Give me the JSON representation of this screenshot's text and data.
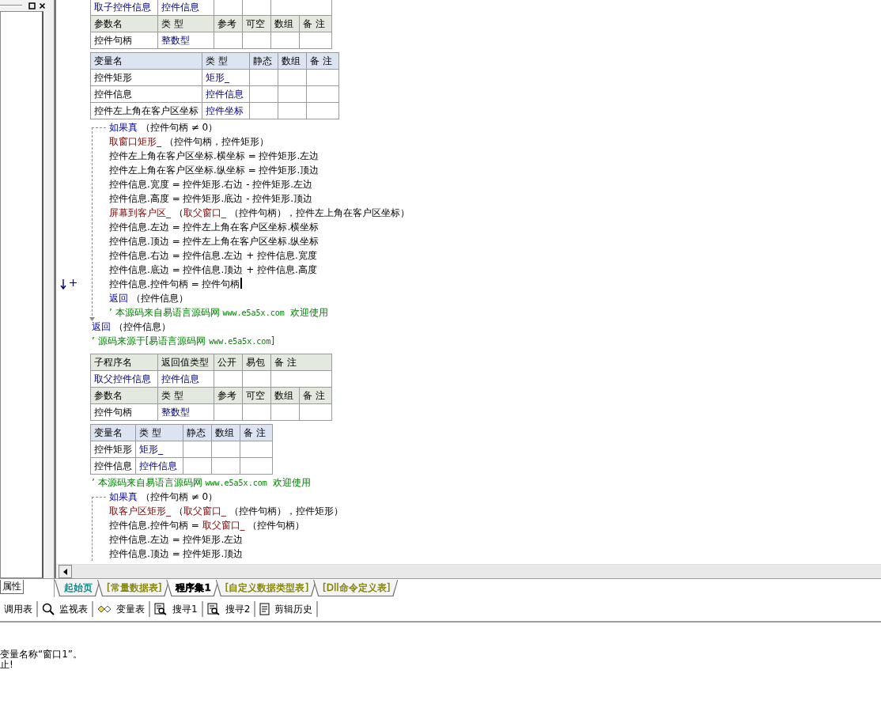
{
  "left_panel": {
    "tab": "属性"
  },
  "program": [
    {
      "kind": "sub_table",
      "row": {
        "name": "取子控件信息",
        "type": "控件信息"
      },
      "param_header": [
        "参数名",
        "类 型",
        "参考",
        "可空",
        "数组",
        "备 注"
      ],
      "params": [
        {
          "name": "控件句柄",
          "type": "整数型"
        }
      ]
    },
    {
      "kind": "var_table",
      "header": [
        "变量名",
        "类 型",
        "静态",
        "数组",
        "备 注"
      ],
      "rows": [
        {
          "name": "控件矩形",
          "type": "矩形_"
        },
        {
          "name": "控件信息",
          "type": "控件信息"
        },
        {
          "name": "控件左上角在客户区坐标",
          "type": "控件坐标"
        }
      ]
    },
    {
      "kind": "code",
      "lines": [
        {
          "kind": "if",
          "current": false,
          "end_arrow": true,
          "segments": [
            {
              "kind": "kw",
              "text": "如果真"
            },
            {
              "kind": "text",
              "text": " （控件句柄 ≠ 0）"
            }
          ],
          "children": [
            {
              "kind": "line",
              "current": false,
              "segments": [
                {
                  "kind": "fn",
                  "text": "取窗口矩形_"
                },
                {
                  "kind": "text",
                  "text": " （控件句柄，控件矩形）"
                }
              ]
            },
            {
              "kind": "line",
              "current": false,
              "segments": [
                {
                  "kind": "text",
                  "text": "控件左上角在客户区坐标.横坐标 = 控件矩形.左边"
                }
              ]
            },
            {
              "kind": "line",
              "current": false,
              "segments": [
                {
                  "kind": "text",
                  "text": "控件左上角在客户区坐标.纵坐标 = 控件矩形.顶边"
                }
              ]
            },
            {
              "kind": "line",
              "current": false,
              "segments": [
                {
                  "kind": "text",
                  "text": "控件信息.宽度 = 控件矩形.右边 - 控件矩形.左边"
                }
              ]
            },
            {
              "kind": "line",
              "current": false,
              "segments": [
                {
                  "kind": "text",
                  "text": "控件信息.高度 = 控件矩形.底边 - 控件矩形.顶边"
                }
              ]
            },
            {
              "kind": "line",
              "current": false,
              "segments": [
                {
                  "kind": "fn",
                  "text": "屏幕到客户区_"
                },
                {
                  "kind": "text",
                  "text": " （"
                },
                {
                  "kind": "fn",
                  "text": "取父窗口_"
                },
                {
                  "kind": "text",
                  "text": " （控件句柄），控件左上角在客户区坐标）"
                }
              ]
            },
            {
              "kind": "line",
              "current": false,
              "segments": [
                {
                  "kind": "text",
                  "text": "控件信息.左边 = 控件左上角在客户区坐标.横坐标"
                }
              ]
            },
            {
              "kind": "line",
              "current": false,
              "segments": [
                {
                  "kind": "text",
                  "text": "控件信息.顶边 = 控件左上角在客户区坐标.纵坐标"
                }
              ]
            },
            {
              "kind": "line",
              "current": false,
              "segments": [
                {
                  "kind": "text",
                  "text": "控件信息.右边 = 控件信息.左边 + 控件信息.宽度"
                }
              ]
            },
            {
              "kind": "line",
              "current": false,
              "segments": [
                {
                  "kind": "text",
                  "text": "控件信息.底边 = 控件信息.顶边 + 控件信息.高度"
                }
              ]
            },
            {
              "kind": "line",
              "current": true,
              "segments": [
                {
                  "kind": "text",
                  "text": "控件信息.控件句柄 = 控件句柄"
                }
              ]
            },
            {
              "kind": "line",
              "current": false,
              "segments": [
                {
                  "kind": "kw",
                  "text": "返回"
                },
                {
                  "kind": "text",
                  "text": " （控件信息）"
                }
              ]
            },
            {
              "kind": "line",
              "current": false,
              "segments": [
                {
                  "kind": "comment",
                  "text": "’ 本源码来自易语言源码网 "
                },
                {
                  "kind": "url",
                  "text": "www.e5a5x.com"
                },
                {
                  "kind": "comment",
                  "text": "  欢迎使用"
                }
              ]
            }
          ]
        },
        {
          "kind": "line",
          "current": false,
          "segments": [
            {
              "kind": "kw",
              "text": "返回"
            },
            {
              "kind": "text",
              "text": " （控件信息）"
            }
          ]
        },
        {
          "kind": "line",
          "current": false,
          "segments": [
            {
              "kind": "comment",
              "text": "’ 源码来源于[易语言源码网 "
            },
            {
              "kind": "url",
              "text": "www.e5a5x.com"
            },
            {
              "kind": "comment",
              "text": "]"
            }
          ]
        }
      ]
    },
    {
      "kind": "sub_table",
      "header": [
        "子程序名",
        "返回值类型",
        "公开",
        "易包",
        "备 注"
      ],
      "row": {
        "name": "取父控件信息",
        "type": "控件信息"
      },
      "param_header": [
        "参数名",
        "类 型",
        "参考",
        "可空",
        "数组",
        "备 注"
      ],
      "params": [
        {
          "name": "控件句柄",
          "type": "整数型"
        }
      ]
    },
    {
      "kind": "var_table",
      "header": [
        "变量名",
        "类 型",
        "静态",
        "数组",
        "备 注"
      ],
      "rows": [
        {
          "name": "控件矩形",
          "type": "矩形_"
        },
        {
          "name": "控件信息",
          "type": "控件信息"
        }
      ]
    },
    {
      "kind": "code",
      "lines": [
        {
          "kind": "line",
          "current": false,
          "segments": [
            {
              "kind": "comment",
              "text": "’ 本源码来自易语言源码网 "
            },
            {
              "kind": "url",
              "text": "www.e5a5x.com"
            },
            {
              "kind": "comment",
              "text": "  欢迎使用"
            }
          ]
        },
        {
          "kind": "if",
          "current": false,
          "end_arrow": false,
          "segments": [
            {
              "kind": "kw",
              "text": "如果真"
            },
            {
              "kind": "text",
              "text": " （控件句柄 ≠ 0）"
            }
          ],
          "children": [
            {
              "kind": "line",
              "current": false,
              "segments": [
                {
                  "kind": "fn",
                  "text": "取客户区矩形_"
                },
                {
                  "kind": "text",
                  "text": " （"
                },
                {
                  "kind": "fn",
                  "text": "取父窗口_"
                },
                {
                  "kind": "text",
                  "text": " （控件句柄），控件矩形）"
                }
              ]
            },
            {
              "kind": "line",
              "current": false,
              "segments": [
                {
                  "kind": "text",
                  "text": "控件信息.控件句柄 = "
                },
                {
                  "kind": "fn",
                  "text": "取父窗口_"
                },
                {
                  "kind": "text",
                  "text": " （控件句柄）"
                }
              ]
            },
            {
              "kind": "line",
              "current": false,
              "segments": [
                {
                  "kind": "text",
                  "text": "控件信息.左边 = 控件矩形.左边"
                }
              ]
            },
            {
              "kind": "line",
              "current": false,
              "segments": [
                {
                  "kind": "text",
                  "text": "控件信息.顶边 = 控件矩形.顶边"
                }
              ]
            }
          ]
        }
      ]
    }
  ],
  "editor_tabs": [
    {
      "label": "起始页",
      "selected": false,
      "color": "#008080"
    },
    {
      "label": "[常量数据表]",
      "selected": false,
      "color": "#808000"
    },
    {
      "label": "程序集1",
      "selected": true,
      "color": "#000000"
    },
    {
      "label": "[自定义数据类型表]",
      "selected": false,
      "color": "#808000"
    },
    {
      "label": "[Dll命令定义表]",
      "selected": false,
      "color": "#808000"
    }
  ],
  "toolbar": [
    {
      "kind": "plain",
      "label": "调用表"
    },
    {
      "kind": "watch",
      "label": "监视表"
    },
    {
      "kind": "variables",
      "label": "变量表"
    },
    {
      "kind": "find",
      "label": "搜寻1"
    },
    {
      "kind": "find",
      "label": "搜寻2"
    },
    {
      "kind": "history",
      "label": "剪辑历史"
    }
  ],
  "output": {
    "lines": [
      "变量名称“窗口1”。",
      "止!"
    ]
  }
}
